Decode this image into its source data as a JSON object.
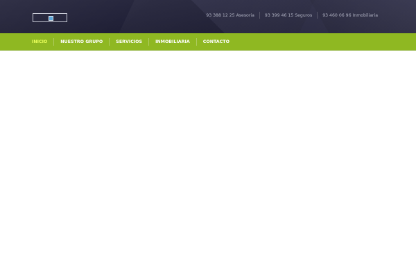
{
  "header": {
    "phones": [
      {
        "text": "93 388 12 25 Asesoria"
      },
      {
        "text": "93 399 46 15 Seguros"
      },
      {
        "text": "93 460 06 96 Inmobiliaria"
      }
    ]
  },
  "nav": {
    "items": [
      {
        "label": "INICIO",
        "active": true
      },
      {
        "label": "NUESTRO GRUPO",
        "active": false
      },
      {
        "label": "SERVICIOS",
        "active": false
      },
      {
        "label": "INMOBILIARIA",
        "active": false
      },
      {
        "label": "CONTACTO",
        "active": false
      }
    ]
  },
  "colors": {
    "header_bg": "#26263e",
    "nav_bg": "#8fb822",
    "nav_active": "#eaff5a",
    "nav_text": "#ffffff",
    "phone_text": "#aeb0c0"
  },
  "icons": {
    "logo": "logo-icon"
  }
}
